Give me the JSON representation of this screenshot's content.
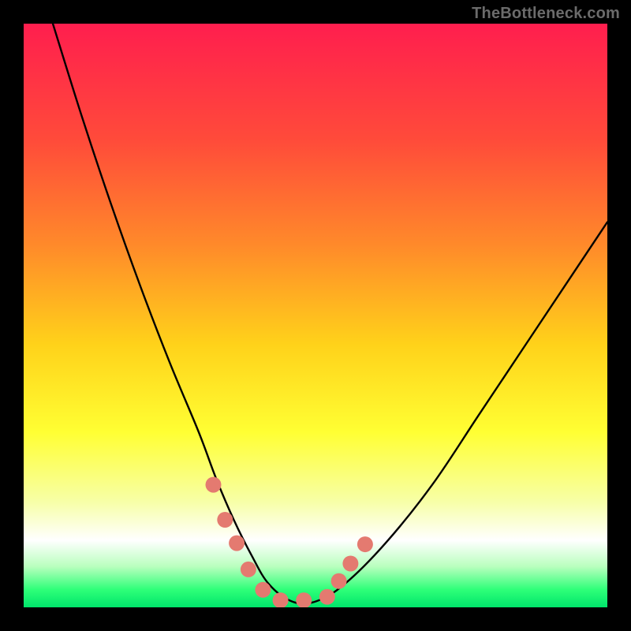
{
  "watermark": {
    "text": "TheBottleneck.com"
  },
  "chart_data": {
    "type": "line",
    "title": "",
    "xlabel": "",
    "ylabel": "",
    "xlim": [
      0,
      100
    ],
    "ylim": [
      0,
      100
    ],
    "grid": false,
    "legend": false,
    "gradient_stops": [
      {
        "offset": 0,
        "color": "#ff1e4e"
      },
      {
        "offset": 0.2,
        "color": "#ff4b3a"
      },
      {
        "offset": 0.38,
        "color": "#ff8a2a"
      },
      {
        "offset": 0.55,
        "color": "#ffd21a"
      },
      {
        "offset": 0.7,
        "color": "#ffff33"
      },
      {
        "offset": 0.82,
        "color": "#f7ffa8"
      },
      {
        "offset": 0.885,
        "color": "#ffffff"
      },
      {
        "offset": 0.93,
        "color": "#b9ffbe"
      },
      {
        "offset": 0.97,
        "color": "#2dff78"
      },
      {
        "offset": 1.0,
        "color": "#00e56b"
      }
    ],
    "series": [
      {
        "name": "bottleneck-curve",
        "x": [
          5,
          10,
          15,
          20,
          25,
          30,
          33,
          36,
          39,
          42,
          46,
          50,
          55,
          62,
          70,
          78,
          86,
          94,
          100
        ],
        "values": [
          100,
          84,
          69,
          55,
          42,
          30,
          22,
          15,
          9,
          4,
          1,
          1,
          4,
          11,
          21,
          33,
          45,
          57,
          66
        ]
      }
    ],
    "markers": {
      "name": "highlight-dots",
      "color": "#e47a70",
      "radius_pct": 1.35,
      "points": [
        {
          "x": 32.5,
          "y": 21.0
        },
        {
          "x": 34.5,
          "y": 15.0
        },
        {
          "x": 36.5,
          "y": 11.0
        },
        {
          "x": 38.5,
          "y": 6.5
        },
        {
          "x": 41.0,
          "y": 3.0
        },
        {
          "x": 44.0,
          "y": 1.2
        },
        {
          "x": 48.0,
          "y": 1.2
        },
        {
          "x": 52.0,
          "y": 1.8
        },
        {
          "x": 54.0,
          "y": 4.5
        },
        {
          "x": 56.0,
          "y": 7.5
        },
        {
          "x": 58.5,
          "y": 10.8
        }
      ]
    }
  }
}
